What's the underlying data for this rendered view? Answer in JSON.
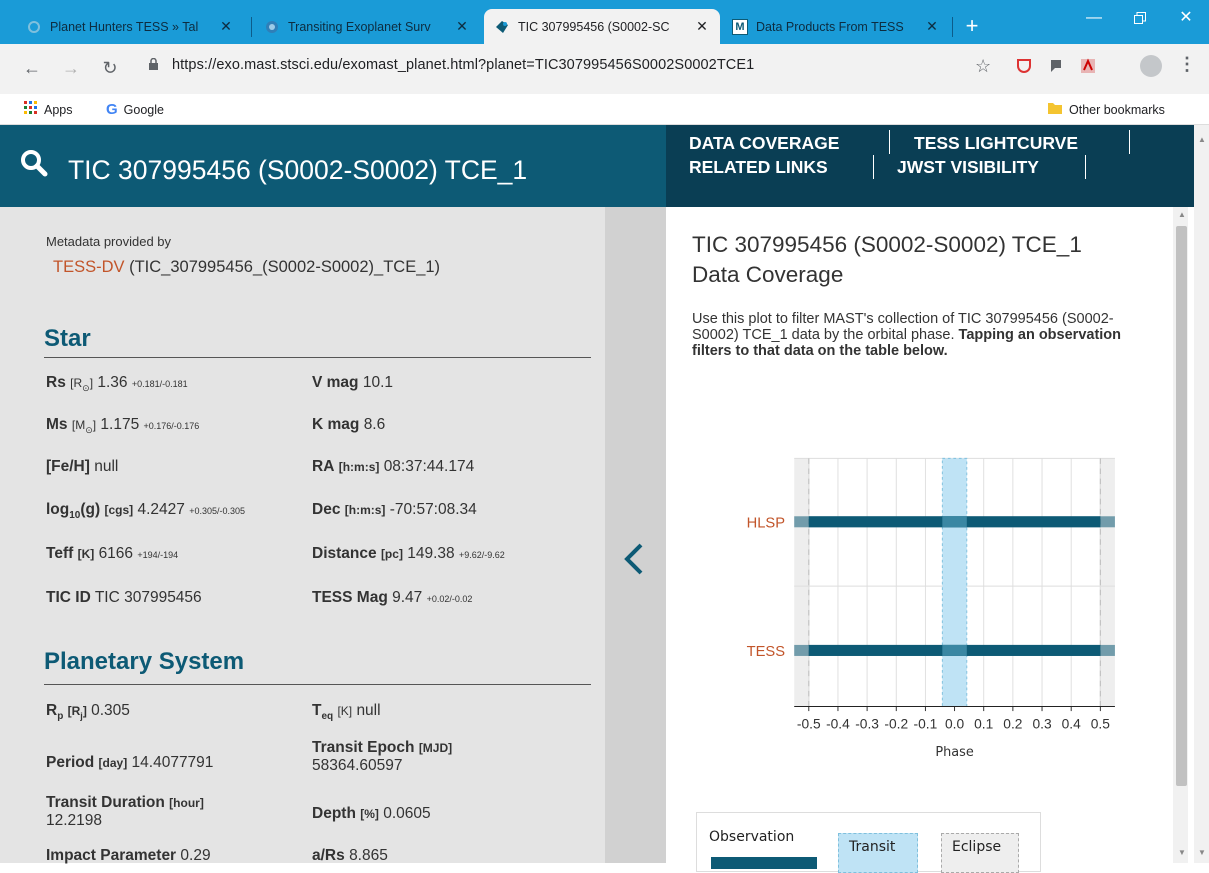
{
  "browser": {
    "tabs": [
      {
        "title": "Planet Hunters TESS » Tal",
        "state": "inactive"
      },
      {
        "title": "Transiting Exoplanet Surv",
        "state": "inactive"
      },
      {
        "title": "TIC 307995456 (S0002-SC",
        "state": "active"
      },
      {
        "title": "Data Products From TESS",
        "state": "inactive"
      }
    ],
    "tab_close": "✕",
    "new_tab": "+",
    "url": "https://exo.mast.stsci.edu/exomast_planet.html?planet=TIC307995456S0002S0002TCE1",
    "bookmarks": {
      "apps": "Apps",
      "google": "Google",
      "other": "Other bookmarks"
    }
  },
  "header": {
    "title": "TIC 307995456 (S0002-S0002) TCE_1"
  },
  "nav": {
    "data_coverage": "DATA COVERAGE",
    "tess_lightcurve": "TESS LIGHTCURVE",
    "related_links": "RELATED LINKS",
    "jwst_visibility": "JWST VISIBILITY"
  },
  "metadata": {
    "label": "Metadata provided by",
    "link": "TESS-DV",
    "source": " (TIC_307995456_(S0002-S0002)_TCE_1)"
  },
  "star": {
    "heading": "Star",
    "rs": {
      "name": "Rs",
      "unit": "[R",
      "unit_sub": "⊙",
      "unit_end": "]",
      "value": "1.36",
      "err": "+0.181/-0.181"
    },
    "vmag": {
      "name": "V mag",
      "value": "10.1"
    },
    "ms": {
      "name": "Ms",
      "unit": "[M",
      "unit_sub": "⊙",
      "unit_end": "]",
      "value": "1.175",
      "err": "+0.176/-0.176"
    },
    "kmag": {
      "name": "K mag",
      "value": "8.6"
    },
    "feh": {
      "name": "[Fe/H]",
      "value": "null"
    },
    "ra": {
      "name": "RA",
      "unit": "[h:m:s]",
      "value": "08:37:44.174"
    },
    "logg": {
      "name": "log",
      "sub": "10",
      "name2": "(g)",
      "unit": "[cgs]",
      "value": "4.2427",
      "err": "+0.305/-0.305"
    },
    "dec": {
      "name": "Dec",
      "unit": "[h:m:s]",
      "value": "-70:57:08.34"
    },
    "teff": {
      "name": "Teff",
      "unit": "[K]",
      "value": "6166",
      "err": "+194/-194"
    },
    "distance": {
      "name": "Distance",
      "unit": "[pc]",
      "value": "149.38",
      "err": "+9.62/-9.62"
    },
    "ticid": {
      "name": "TIC ID",
      "value": "TIC 307995456"
    },
    "tessmag": {
      "name": "TESS Mag",
      "value": "9.47",
      "err": "+0.02/-0.02"
    }
  },
  "planetary": {
    "heading": "Planetary System",
    "rp": {
      "name": "R",
      "sub": "p",
      "unit": "[R",
      "unit_sub": "j",
      "unit_end": "]",
      "value": "0.305"
    },
    "teq": {
      "name": "T",
      "sub": "eq",
      "unit": "[K]",
      "value": "null"
    },
    "period": {
      "name": "Period",
      "unit": "[day]",
      "value": "14.4077791"
    },
    "epoch": {
      "name": "Transit Epoch",
      "unit": "[MJD]",
      "value": "58364.60597"
    },
    "duration": {
      "name": "Transit Duration",
      "unit": "[hour]",
      "value": "12.2198"
    },
    "depth": {
      "name": "Depth",
      "unit": "[%]",
      "value": "0.0605"
    },
    "impact": {
      "name": "Impact Parameter",
      "value": "0.29"
    },
    "ars": {
      "name": "a/Rs",
      "value": "8.865"
    }
  },
  "coverage": {
    "title": "TIC 307995456 (S0002-S0002) TCE_1 Data Coverage",
    "desc": "Use this plot to filter MAST's collection of TIC 307995456 (S0002-S0002) TCE_1 data by the orbital phase. ",
    "desc_bold": "Tapping an observation filters to that data on the table below."
  },
  "chart_data": {
    "type": "bar",
    "categories": [
      "HLSP",
      "TESS"
    ],
    "series": [
      {
        "name": "Observation",
        "ranges": [
          [
            -0.5,
            0.5
          ],
          [
            -0.5,
            0.5
          ]
        ]
      }
    ],
    "xlabel": "Phase",
    "ylabel": "",
    "xlim": [
      -0.55,
      0.55
    ],
    "xticks": [
      "-0.5",
      "-0.4",
      "-0.3",
      "-0.2",
      "-0.1",
      "0.0",
      "0.1",
      "0.2",
      "0.3",
      "0.4",
      "0.5"
    ],
    "transit_window": [
      -0.042,
      0.042
    ],
    "eclipse_markers": [
      -0.5,
      0.5
    ],
    "colors": {
      "bar": "#0d5a75",
      "transit": "#bfe3f5",
      "label": "#c2552a"
    },
    "legend": {
      "observation": "Observation",
      "transit": "Transit",
      "eclipse": "Eclipse"
    }
  }
}
